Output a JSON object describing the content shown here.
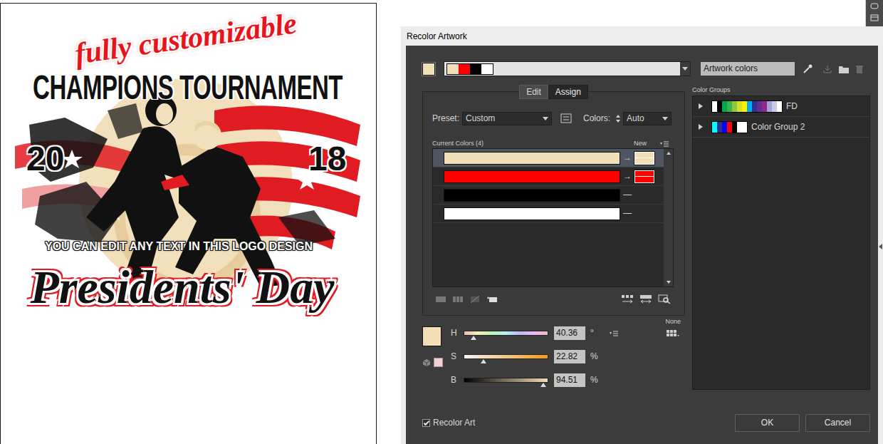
{
  "artwork": {
    "script": "fully customizable",
    "title": "CHAMPIONS TOURNAMENT",
    "year_left": "20",
    "year_right": "18",
    "tagline": "YOU CAN EDIT ANY TEXT IN THIS LOGO DESIGN",
    "banner": "Presidents' Day"
  },
  "dialog": {
    "title": "Recolor Artwork"
  },
  "group_name": {
    "value": "Artwork colors"
  },
  "tabs": [
    {
      "label": "Edit",
      "selected": false
    },
    {
      "label": "Assign",
      "selected": true
    }
  ],
  "preset": {
    "label": "Preset:",
    "value": "Custom"
  },
  "colors": {
    "label": "Colors:",
    "value": "Auto"
  },
  "current_colors": {
    "header": "Current Colors (4)",
    "new_label": "New",
    "rows": [
      {
        "color": "#f2deb7",
        "selected": true,
        "marker": "→",
        "new_color": "#f2deb7"
      },
      {
        "color": "#ff0000",
        "selected": false,
        "marker": "→",
        "new_color": "#ff0000"
      },
      {
        "color": "#000000",
        "selected": false,
        "marker": "—",
        "new_color": null
      },
      {
        "color": "#ffffff",
        "selected": false,
        "marker": "—",
        "new_color": null
      }
    ]
  },
  "hsb": {
    "rows": [
      {
        "label": "H",
        "value": "40.36",
        "unit": "°",
        "level": 0.112
      },
      {
        "label": "S",
        "value": "22.82",
        "unit": "%",
        "level": 0.2282
      },
      {
        "label": "B",
        "value": "94.51",
        "unit": "%",
        "level": 0.9451
      }
    ]
  },
  "none_label": "None",
  "color_groups": {
    "header": "Color Groups",
    "items": [
      {
        "name": "FD",
        "expanded": false,
        "swatches": [
          "#ffffff",
          "#000000",
          "#00a651",
          "#39b54a",
          "#8dc63f",
          "#d7df23",
          "#fff200",
          "#00aeef",
          "#2e3192",
          "#662d91",
          "#92278f",
          "#a3a3d6",
          "#c9c9e8",
          "#ffffff"
        ]
      },
      {
        "name": "Color Group 2",
        "expanded": false,
        "swatches": [
          "#00ffff",
          "#2e3192",
          "#0000ff",
          "#ff0000",
          "#000000",
          "#ffffff",
          "#ffffff"
        ]
      }
    ]
  },
  "recolor_art": {
    "label": "Recolor Art",
    "checked": true
  },
  "buttons": [
    {
      "label": "OK"
    },
    {
      "label": "Cancel"
    }
  ]
}
